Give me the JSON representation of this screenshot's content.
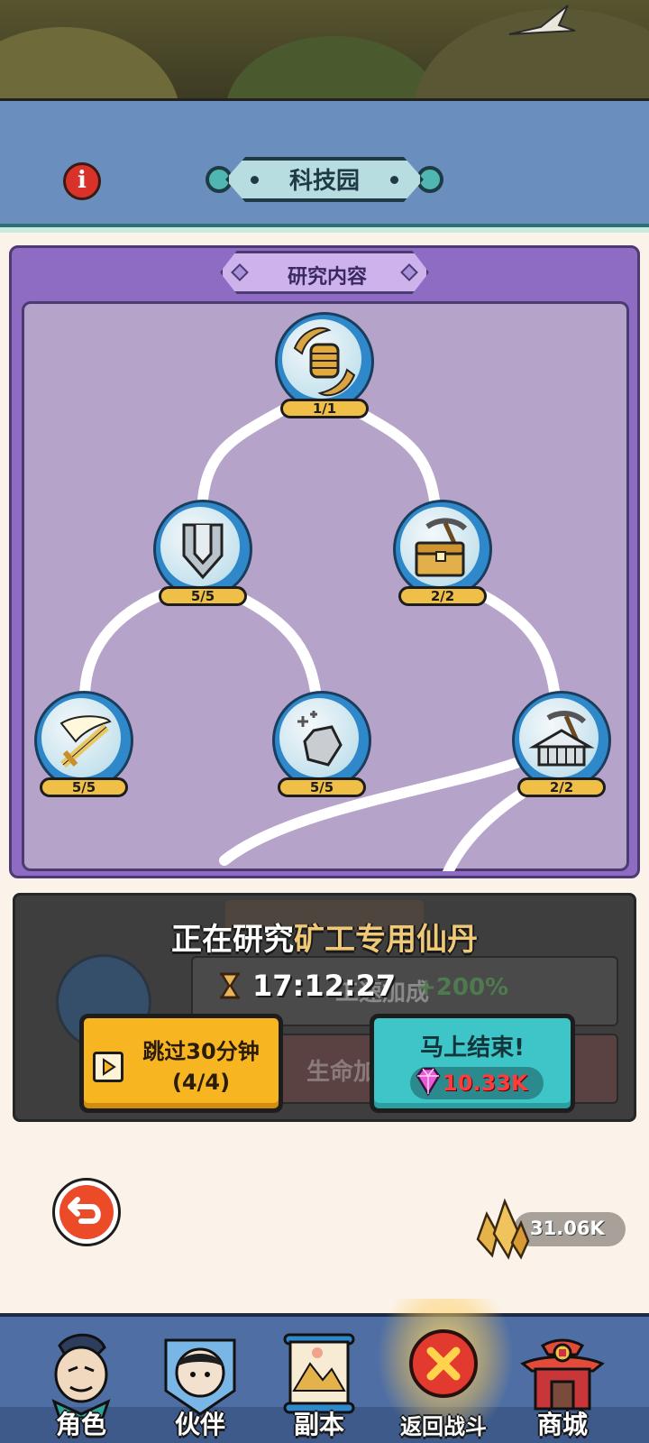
{
  "header": {
    "title": "科技园"
  },
  "research": {
    "section_title": "研究内容",
    "nodes": [
      {
        "name": "power-fist",
        "icon": "fist-icon",
        "level": "1/1"
      },
      {
        "name": "defense-armor",
        "icon": "armor-icon",
        "level": "5/5"
      },
      {
        "name": "mining-chest",
        "icon": "pickaxe-chest-icon",
        "level": "2/2"
      },
      {
        "name": "sword-slash",
        "icon": "sword-icon",
        "level": "5/5"
      },
      {
        "name": "ore-stone",
        "icon": "ore-icon",
        "level": "5/5"
      },
      {
        "name": "mine-camp",
        "icon": "pickaxe-camp-icon",
        "level": "2/2"
      }
    ]
  },
  "progress": {
    "prefix": "正在研究",
    "item_name": "矿工专用仙丹",
    "timer": "17:12:27",
    "background_title": "矿工专用仙丹",
    "stat1_label": "工速加成",
    "stat1_value": "+200%",
    "stat2_label": "生命加成",
    "skip_label_line1": "跳过30分钟",
    "skip_label_line2": "(4/4)",
    "finish_label": "马上结束!",
    "finish_cost": "10.33K"
  },
  "currency": {
    "value": "31.06K",
    "icon": "crystal-icon"
  },
  "nav": {
    "items": [
      {
        "label": "角色",
        "icon": "character-icon"
      },
      {
        "label": "伙伴",
        "icon": "partner-icon"
      },
      {
        "label": "副本",
        "icon": "dungeon-scroll-icon"
      },
      {
        "label": "返回战斗",
        "icon": "close-battle-icon"
      },
      {
        "label": "商城",
        "icon": "shop-pagoda-icon"
      }
    ]
  },
  "colors": {
    "panel_purple": "#8e6cc3",
    "node_ring": "#2f88c9",
    "skip_button": "#f6b521",
    "finish_button": "#3ec5c7",
    "cost_red": "#ff3b3b"
  }
}
